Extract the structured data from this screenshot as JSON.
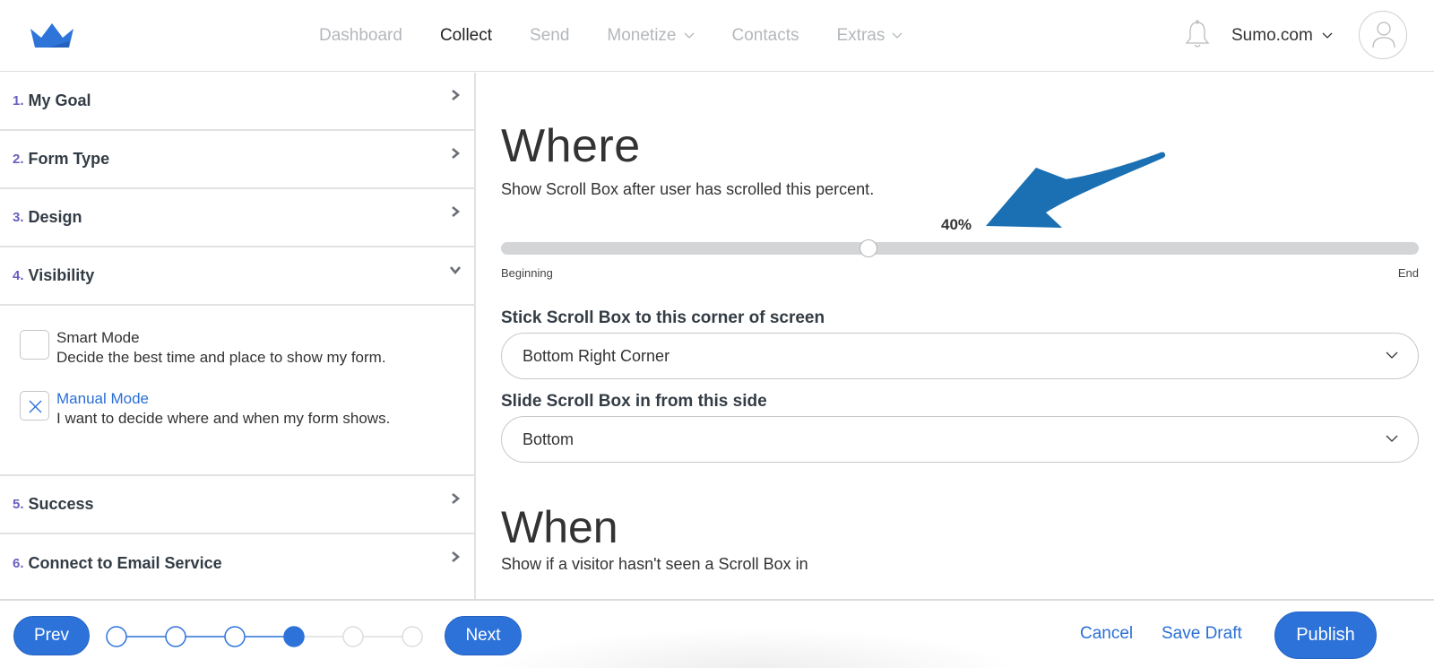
{
  "header": {
    "logo": "crown-logo",
    "nav": [
      {
        "label": "Dashboard",
        "active": false,
        "has_dropdown": false
      },
      {
        "label": "Collect",
        "active": true,
        "has_dropdown": false
      },
      {
        "label": "Send",
        "active": false,
        "has_dropdown": false
      },
      {
        "label": "Monetize",
        "active": false,
        "has_dropdown": true
      },
      {
        "label": "Contacts",
        "active": false,
        "has_dropdown": false
      },
      {
        "label": "Extras",
        "active": false,
        "has_dropdown": true
      }
    ],
    "notifications_icon": "bell-icon",
    "account_label": "Sumo.com",
    "avatar_icon": "user-icon"
  },
  "sidebar": {
    "steps": [
      {
        "number": "1.",
        "label": "My Goal",
        "expanded": false
      },
      {
        "number": "2.",
        "label": "Form Type",
        "expanded": false
      },
      {
        "number": "3.",
        "label": "Design",
        "expanded": false
      },
      {
        "number": "4.",
        "label": "Visibility",
        "expanded": true
      },
      {
        "number": "5.",
        "label": "Success",
        "expanded": false
      },
      {
        "number": "6.",
        "label": "Connect to Email Service",
        "expanded": false
      }
    ],
    "visibility_modes": [
      {
        "title": "Smart Mode",
        "description": "Decide the best time and place to show my form.",
        "selected": false
      },
      {
        "title": "Manual Mode",
        "description": "I want to decide where and when my form shows.",
        "selected": true
      }
    ]
  },
  "main": {
    "where": {
      "heading": "Where",
      "description": "Show Scroll Box after user has scrolled this percent.",
      "scroll_percent_label": "40%",
      "scroll_percent": 40,
      "slider_min_label": "Beginning",
      "slider_max_label": "End"
    },
    "corner_field": {
      "label": "Stick Scroll Box to this corner of screen",
      "value": "Bottom Right Corner"
    },
    "side_field": {
      "label": "Slide Scroll Box in from this side",
      "value": "Bottom"
    },
    "when": {
      "heading": "When",
      "description": "Show if a visitor hasn't seen a Scroll Box in"
    },
    "annotation": "arrow pointing to 40%"
  },
  "footer": {
    "prev_label": "Prev",
    "next_label": "Next",
    "cancel_label": "Cancel",
    "save_draft_label": "Save Draft",
    "publish_label": "Publish",
    "total_steps": 6,
    "current_step": 4
  },
  "colors": {
    "accent": "#2c72d9",
    "link": "#2a6fd6",
    "step_number": "#6a5fc1",
    "annotation_arrow": "#1a70b2",
    "track": "#d4d5d7"
  }
}
